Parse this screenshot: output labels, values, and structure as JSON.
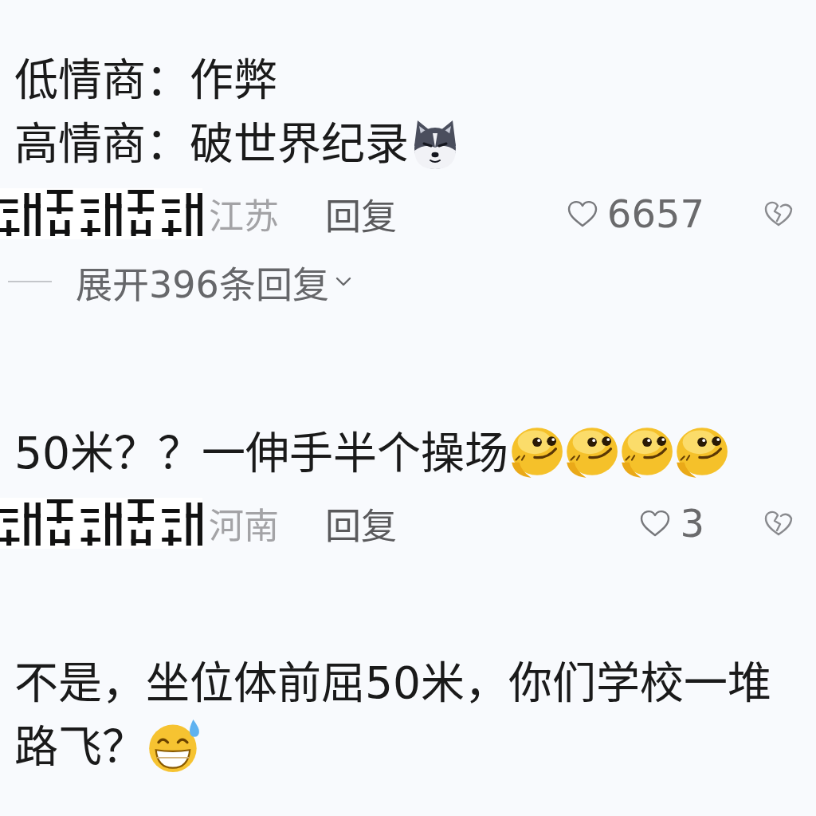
{
  "comments": [
    {
      "lines": [
        {
          "text": "低情商：作弊"
        },
        {
          "text": "高情商：破世界纪录",
          "emojis": [
            {
              "kind": "husky"
            }
          ]
        }
      ],
      "location": "江苏",
      "reply": "回复",
      "likes": "6657",
      "expand_replies": "展开396条回复"
    },
    {
      "lines": [
        {
          "text": "50米？？一伸手半个操场",
          "emojis": [
            {
              "kind": "smirk"
            },
            {
              "kind": "smirk"
            },
            {
              "kind": "smirk"
            },
            {
              "kind": "smirk"
            }
          ]
        }
      ],
      "location": "河南",
      "reply": "回复",
      "likes": "3"
    },
    {
      "lines": [
        {
          "text": "不是，坐位体前屈50米，你们学校一堆"
        },
        {
          "text": "路飞？",
          "emojis": [
            {
              "kind": "grin-sweat"
            }
          ]
        }
      ]
    }
  ]
}
